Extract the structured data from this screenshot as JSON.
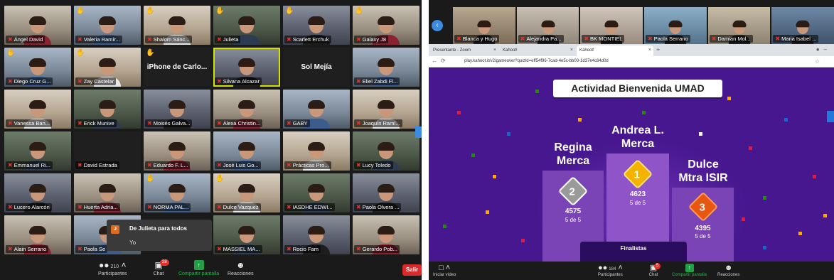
{
  "left": {
    "tiles": [
      {
        "name": "Ángel David",
        "hand": false,
        "kind": "video"
      },
      {
        "name": "Valeria Ramír...",
        "hand": true,
        "kind": "video"
      },
      {
        "name": "Shalom Sánc...",
        "hand": true,
        "kind": "video"
      },
      {
        "name": "Julieta",
        "hand": true,
        "kind": "video"
      },
      {
        "name": "Scarlett Erchuk",
        "hand": true,
        "kind": "video"
      },
      {
        "name": "Galaxy J8",
        "hand": true,
        "kind": "video"
      },
      {
        "name": "Diego Cruz G...",
        "hand": true,
        "kind": "video"
      },
      {
        "name": "Zay Castelar",
        "hand": true,
        "kind": "video"
      },
      {
        "name": "iPhone de Carlo...",
        "hand": true,
        "kind": "card"
      },
      {
        "name": "Silvana Alcazar",
        "hand": false,
        "kind": "video",
        "active": true
      },
      {
        "name": "Sol Mejía",
        "hand": false,
        "kind": "card"
      },
      {
        "name": "Eliel Zabdi Fl...",
        "hand": false,
        "kind": "video"
      },
      {
        "name": "Vanessa Ban...",
        "hand": false,
        "kind": "video"
      },
      {
        "name": "Erick Munive",
        "hand": false,
        "kind": "video"
      },
      {
        "name": "Moisés Galva...",
        "hand": false,
        "kind": "video"
      },
      {
        "name": "Alexa Christin...",
        "hand": false,
        "kind": "video"
      },
      {
        "name": "GABY",
        "hand": false,
        "kind": "video"
      },
      {
        "name": "Joaquín Ramí...",
        "hand": false,
        "kind": "video"
      },
      {
        "name": "Emmanuel Ri...",
        "hand": false,
        "kind": "video"
      },
      {
        "name": "David Estrada",
        "hand": false,
        "kind": "dark"
      },
      {
        "name": "Eduardo F. L...",
        "hand": false,
        "kind": "video"
      },
      {
        "name": "José Luis Go...",
        "hand": false,
        "kind": "video"
      },
      {
        "name": "Prácticas Pro...",
        "hand": false,
        "kind": "video"
      },
      {
        "name": "Lucy Toledo",
        "hand": false,
        "kind": "video"
      },
      {
        "name": "Lucero Alarcón",
        "hand": false,
        "kind": "video"
      },
      {
        "name": "Huerta Adria...",
        "hand": false,
        "kind": "video"
      },
      {
        "name": "NORMA PAL...",
        "hand": true,
        "kind": "video"
      },
      {
        "name": "Dulce Vazquez",
        "hand": true,
        "kind": "video"
      },
      {
        "name": "IASDHE EDWI...",
        "hand": false,
        "kind": "video"
      },
      {
        "name": "Paola Olvera ...",
        "hand": false,
        "kind": "video"
      },
      {
        "name": "Alain Serrano",
        "hand": false,
        "kind": "video"
      },
      {
        "name": "Paola Se",
        "hand": false,
        "kind": "video"
      },
      {
        "name": "",
        "hand": false,
        "kind": "hidden"
      },
      {
        "name": "MASSIEL MA...",
        "hand": false,
        "kind": "video"
      },
      {
        "name": "Rocio Fam",
        "hand": false,
        "kind": "video"
      },
      {
        "name": "Gerardo Pob...",
        "hand": false,
        "kind": "video"
      }
    ],
    "chat_popup": {
      "avatar": "J",
      "title": "De Julieta para todos",
      "message": "Yo"
    },
    "toolbar": {
      "participants_count": "210",
      "participants_label": "Participantes",
      "chat_badge": "28",
      "chat_label": "Chat",
      "share_label": "Compartir pantalla",
      "reactions_label": "Reacciones",
      "leave_label": "Salir"
    }
  },
  "right": {
    "strip_names": [
      "Blanca y Hugo",
      "Alejandra Pa...",
      "BK MONTIEL",
      "Paola Serrano",
      "Damian Mol...",
      "Maria Isabel ..."
    ],
    "browser": {
      "tab1": "Presentante - Zoom",
      "tab2": "Kahoot!",
      "tab3": "Kahoot!",
      "url": "play.kahoot.it/v2/gameover?quizId=eff54f96-7cad-4e5c-bb00-1d37e4c84d0d"
    },
    "kahoot": {
      "title": "Actividad Bienvenida UMAD",
      "podium": [
        {
          "place": "2",
          "name_line1": "Regina",
          "name_line2": "Merca",
          "score": "4575",
          "correct": "5 de 5"
        },
        {
          "place": "1",
          "name_line1": "Andrea L.",
          "name_line2": "Merca",
          "score": "4623",
          "correct": "5 de 5"
        },
        {
          "place": "3",
          "name_line1": "Dulce",
          "name_line2": "Mtra ISIR",
          "score": "4395",
          "correct": "5 de 5"
        }
      ],
      "finalists_label": "Finalistas"
    },
    "toolbar": {
      "video_label": "Iniciar vídeo",
      "participants_count": "184",
      "participants_label": "Participantes",
      "chat_badge": "5",
      "chat_label": "Chat",
      "share_label": "Compartir pantalla",
      "reactions_label": "Reacciones"
    }
  }
}
